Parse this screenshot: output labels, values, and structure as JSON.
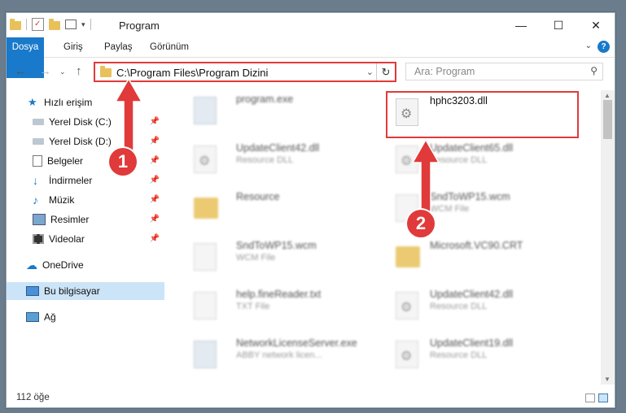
{
  "window": {
    "title": "Program",
    "controls": {
      "minimize": "—",
      "maximize": "☐",
      "close": "✕"
    }
  },
  "ribbon": {
    "tabs": [
      "Dosya",
      "Giriş",
      "Paylaş",
      "Görünüm"
    ],
    "help": "?"
  },
  "address": {
    "path": "C:\\Program Files\\Program Dizini",
    "search_placeholder": "Ara: Program"
  },
  "sidebar": {
    "quick_access": "Hızlı erişim",
    "items": [
      {
        "label": "Yerel Disk (C:)",
        "pinned": true
      },
      {
        "label": "Yerel Disk (D:)",
        "pinned": true
      },
      {
        "label": "Belgeler",
        "pinned": true
      },
      {
        "label": "İndirmeler",
        "pinned": true
      },
      {
        "label": "Müzik",
        "pinned": true
      },
      {
        "label": "Resimler",
        "pinned": true
      },
      {
        "label": "Videolar",
        "pinned": true
      }
    ],
    "onedrive": "OneDrive",
    "this_pc": "Bu bilgisayar",
    "network": "Ağ"
  },
  "files": {
    "left_column": [
      {
        "name": "program.exe",
        "desc": "",
        "type": "exe"
      },
      {
        "name": "UpdateClient42.dll",
        "desc": "Resource DLL",
        "type": "dll"
      },
      {
        "name": "Resource",
        "desc": "",
        "type": "folder"
      },
      {
        "name": "SndToWP15.wcm",
        "desc": "WCM File",
        "type": "file"
      },
      {
        "name": "help.fineReader.txt",
        "desc": "TXT File",
        "type": "file"
      },
      {
        "name": "NetworkLicenseServer.exe",
        "desc": "ABBY network licen...",
        "type": "exe"
      }
    ],
    "right_column": [
      {
        "name": "hphc3203.dll",
        "desc": "",
        "type": "dll",
        "highlighted": true
      },
      {
        "name": "UpdateClient65.dll",
        "desc": "Resource DLL",
        "type": "dll"
      },
      {
        "name": "SndToWP15.wcm",
        "desc": "WCM File",
        "type": "file"
      },
      {
        "name": "Microsoft.VC90.CRT",
        "desc": "",
        "type": "folder"
      },
      {
        "name": "UpdateClient42.dll",
        "desc": "Resource DLL",
        "type": "dll"
      },
      {
        "name": "UpdateClient19.dll",
        "desc": "Resource DLL",
        "type": "dll"
      }
    ]
  },
  "status": {
    "item_count": "112 öğe"
  },
  "annotations": {
    "step1": "1",
    "step2": "2",
    "accent_color": "#e03a3a"
  }
}
